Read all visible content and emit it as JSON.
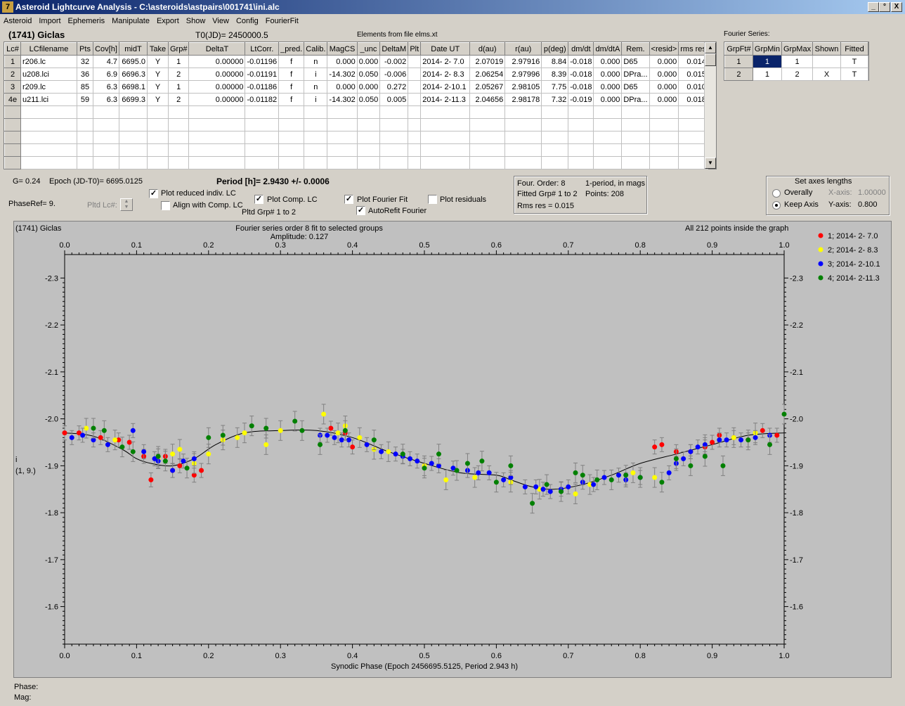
{
  "window": {
    "title": "Asteroid Lightcurve Analysis - C:\\asteroids\\astpairs\\001741\\ini.alc",
    "controls": [
      "_",
      "°",
      "X"
    ]
  },
  "menu": [
    "Asteroid",
    "Import",
    "Ephemeris",
    "Manipulate",
    "Export",
    "Show",
    "View",
    "Config",
    "FourierFit"
  ],
  "header": {
    "asteroid_name": "(1741) Giclas",
    "t0": "T0(JD)= 2450000.5",
    "elements": "Elements from file elms.xt"
  },
  "lc_table": {
    "columns": [
      "Lc#",
      "LCfilename",
      "Pts",
      "Cov[h]",
      "midT",
      "Take",
      "Grp#",
      "DeltaT",
      "LtCorr.",
      "_pred.",
      "Calib.",
      "MagCS",
      "_unc",
      "DeltaM",
      "Plt",
      "Date UT",
      "d(au)",
      "r(au)",
      "p(deg)",
      "dm/dt",
      "dm/dtA",
      "Rem.",
      "<resid>",
      "rms res"
    ],
    "rows": [
      [
        "1",
        "r206.lc",
        "32",
        "4.7",
        "6695.0",
        "Y",
        "1",
        "0.00000",
        "-0.01196",
        "f",
        "n",
        "0.000",
        "0.000",
        "-0.002",
        "",
        "2014- 2- 7.0",
        "2.07019",
        "2.97916",
        "8.84",
        "-0.018",
        "0.000",
        "D65",
        "0.000",
        "0.014"
      ],
      [
        "2",
        "u208.lci",
        "36",
        "6.9",
        "6696.3",
        "Y",
        "2",
        "0.00000",
        "-0.01191",
        "f",
        "i",
        "-14.302",
        "0.050",
        "-0.006",
        "",
        "2014- 2- 8.3",
        "2.06254",
        "2.97996",
        "8.39",
        "-0.018",
        "0.000",
        "DPra...",
        "0.000",
        "0.015"
      ],
      [
        "3",
        "r209.lc",
        "85",
        "6.3",
        "6698.1",
        "Y",
        "1",
        "0.00000",
        "-0.01186",
        "f",
        "n",
        "0.000",
        "0.000",
        "0.272",
        "",
        "2014- 2-10.1",
        "2.05267",
        "2.98105",
        "7.75",
        "-0.018",
        "0.000",
        "D65",
        "0.000",
        "0.010"
      ],
      [
        "4e",
        "u211.lci",
        "59",
        "6.3",
        "6699.3",
        "Y",
        "2",
        "0.00000",
        "-0.01182",
        "f",
        "i",
        "-14.302",
        "0.050",
        "0.005",
        "",
        "2014- 2-11.3",
        "2.04656",
        "2.98178",
        "7.32",
        "-0.019",
        "0.000",
        "DPra...",
        "0.000",
        "0.018"
      ]
    ]
  },
  "fourier_table": {
    "title": "Fourier Series:",
    "columns": [
      "GrpFt#",
      "GrpMin",
      "GrpMax",
      "Shown",
      "Fitted"
    ],
    "rows": [
      [
        "1",
        "1",
        "1",
        "",
        "T"
      ],
      [
        "2",
        "1",
        "2",
        "X",
        "T"
      ]
    ]
  },
  "controls": {
    "g": "G= 0.24",
    "epoch": "Epoch (JD-T0)= 6695.0125",
    "period": "Period [h]= 2.9430 +/- 0.0006",
    "phaseref": "PhaseRef= 9.",
    "pltd_lc": "Pltd Lc#:",
    "plot_reduced": "Plot reduced indiv. LC",
    "align_comp": "Align with Comp. LC",
    "plot_comp": "Plot Comp. LC",
    "pltd_grp": "Pltd Grp#  1  to  2",
    "plot_fourier": "Plot Fourier Fit",
    "autorefit": "AutoRefit Fourier",
    "plot_residuals": "Plot residuals",
    "four_order": "Four. Order:  8",
    "one_period": "1-period, in mags",
    "fitted_grp": "Fitted Grp# 1 to 2",
    "points": "Points: 208",
    "rms": "Rms res     = 0.015",
    "axes_title": "Set axes lengths",
    "overally": "Overally",
    "keep_axis": "Keep Axis",
    "xaxis_label": "X-axis:",
    "xaxis_val": "1.00000",
    "yaxis_label": "Y-axis:",
    "yaxis_val": "0.800"
  },
  "checks": {
    "plot_reduced": true,
    "align_comp": false,
    "plot_comp": true,
    "plot_fourier": true,
    "autorefit": true,
    "plot_residuals": false
  },
  "status": {
    "phase": "Phase:",
    "mag": "Mag:"
  },
  "chart_data": {
    "type": "scatter",
    "title": "Fourier series order 8 fit to selected groups",
    "subtitle": "Amplitude: 0.127",
    "top_left": "(1741) Giclas",
    "top_right": "All 212 points inside the graph",
    "xlabel": "Synodic Phase (Epoch 2456695.5125, Period 2.943 h)",
    "ylabel": "i",
    "ylabel2": "(1, 9.)",
    "xlim": [
      0.0,
      1.0
    ],
    "ylim": [
      -2.35,
      -1.52
    ],
    "y_inverted": true,
    "x_ticks": [
      "0.0",
      "0.1",
      "0.2",
      "0.3",
      "0.4",
      "0.5",
      "0.6",
      "0.7",
      "0.8",
      "0.9",
      "1.0"
    ],
    "y_ticks": [
      "-2.3",
      "-2.2",
      "-2.1",
      "-2.0",
      "-1.9",
      "-1.8",
      "-1.7",
      "-1.6"
    ],
    "series": [
      {
        "name": "1; 2014- 2- 7.0",
        "color": "#ff0000",
        "x": [
          0.0,
          0.02,
          0.05,
          0.075,
          0.09,
          0.11,
          0.12,
          0.14,
          0.15,
          0.16,
          0.18,
          0.19,
          0.37,
          0.39,
          0.4,
          0.82,
          0.83,
          0.85,
          0.87,
          0.89,
          0.9,
          0.91,
          0.93,
          0.95,
          0.97,
          0.99
        ],
        "y": [
          -1.97,
          -1.97,
          -1.96,
          -1.955,
          -1.95,
          -1.92,
          -1.87,
          -1.92,
          -1.89,
          -1.9,
          -1.88,
          -1.89,
          -1.98,
          -1.97,
          -1.94,
          -1.94,
          -1.945,
          -1.93,
          -1.93,
          -1.94,
          -1.95,
          -1.965,
          -1.96,
          -1.955,
          -1.975,
          -1.965
        ]
      },
      {
        "name": "2; 2014- 2- 8.3",
        "color": "#ffff00",
        "x": [
          0.03,
          0.07,
          0.13,
          0.15,
          0.16,
          0.18,
          0.2,
          0.22,
          0.24,
          0.25,
          0.28,
          0.3,
          0.36,
          0.38,
          0.39,
          0.41,
          0.43,
          0.45,
          0.5,
          0.53,
          0.57,
          0.62,
          0.66,
          0.71,
          0.73,
          0.79,
          0.82,
          0.89,
          0.93,
          0.96
        ],
        "y": [
          -1.98,
          -1.955,
          -1.915,
          -1.925,
          -1.935,
          -1.905,
          -1.925,
          -1.955,
          -1.96,
          -1.97,
          -1.945,
          -1.975,
          -2.01,
          -1.97,
          -1.985,
          -1.96,
          -1.935,
          -1.93,
          -1.9,
          -1.87,
          -1.875,
          -1.865,
          -1.85,
          -1.84,
          -1.86,
          -1.885,
          -1.875,
          -1.945,
          -1.96,
          -1.97
        ]
      },
      {
        "name": "3; 2014- 2-10.1",
        "color": "#0000ff",
        "x": [
          0.01,
          0.025,
          0.04,
          0.06,
          0.095,
          0.11,
          0.125,
          0.13,
          0.15,
          0.165,
          0.18,
          0.355,
          0.365,
          0.375,
          0.385,
          0.395,
          0.42,
          0.44,
          0.46,
          0.47,
          0.48,
          0.49,
          0.51,
          0.52,
          0.54,
          0.56,
          0.575,
          0.59,
          0.61,
          0.62,
          0.64,
          0.655,
          0.665,
          0.675,
          0.69,
          0.7,
          0.72,
          0.735,
          0.75,
          0.77,
          0.78,
          0.8,
          0.84,
          0.85,
          0.86,
          0.87,
          0.88,
          0.89,
          0.91,
          0.92,
          0.94,
          0.96,
          0.98
        ],
        "y": [
          -1.96,
          -1.965,
          -1.955,
          -1.945,
          -1.975,
          -1.93,
          -1.915,
          -1.91,
          -1.89,
          -1.91,
          -1.915,
          -1.965,
          -1.965,
          -1.96,
          -1.955,
          -1.955,
          -1.945,
          -1.93,
          -1.925,
          -1.92,
          -1.915,
          -1.91,
          -1.905,
          -1.9,
          -1.895,
          -1.89,
          -1.885,
          -1.885,
          -1.87,
          -1.875,
          -1.855,
          -1.855,
          -1.85,
          -1.845,
          -1.85,
          -1.855,
          -1.865,
          -1.86,
          -1.875,
          -1.88,
          -1.87,
          -1.875,
          -1.885,
          -1.905,
          -1.915,
          -1.93,
          -1.94,
          -1.945,
          -1.955,
          -1.955,
          -1.955,
          -1.96,
          -1.965
        ]
      },
      {
        "name": "4; 2014- 2-11.3",
        "color": "#008000",
        "x": [
          0.04,
          0.055,
          0.08,
          0.095,
          0.13,
          0.14,
          0.17,
          0.2,
          0.22,
          0.26,
          0.28,
          0.32,
          0.33,
          0.355,
          0.39,
          0.43,
          0.47,
          0.5,
          0.52,
          0.545,
          0.56,
          0.58,
          0.6,
          0.62,
          0.65,
          0.67,
          0.69,
          0.71,
          0.72,
          0.74,
          0.76,
          0.78,
          0.8,
          0.83,
          0.85,
          0.87,
          0.89,
          0.915,
          0.95,
          0.98,
          1.0
        ],
        "y": [
          -1.98,
          -1.975,
          -1.94,
          -1.93,
          -1.92,
          -1.91,
          -1.895,
          -1.96,
          -1.965,
          -1.985,
          -1.98,
          -1.995,
          -1.975,
          -1.945,
          -1.975,
          -1.955,
          -1.925,
          -1.895,
          -1.925,
          -1.89,
          -1.905,
          -1.91,
          -1.865,
          -1.9,
          -1.82,
          -1.86,
          -1.845,
          -1.885,
          -1.88,
          -1.87,
          -1.87,
          -1.88,
          -1.875,
          -1.865,
          -1.915,
          -1.9,
          -1.92,
          -1.9,
          -1.955,
          -1.945,
          -2.01
        ]
      }
    ],
    "fourier_fit": {
      "x": [
        0.0,
        0.04,
        0.08,
        0.1,
        0.12,
        0.15,
        0.18,
        0.21,
        0.25,
        0.3,
        0.35,
        0.4,
        0.45,
        0.5,
        0.55,
        0.6,
        0.62,
        0.65,
        0.68,
        0.72,
        0.76,
        0.8,
        0.85,
        0.9,
        0.95,
        1.0
      ],
      "y": [
        -1.97,
        -1.963,
        -1.935,
        -1.915,
        -1.905,
        -1.9,
        -1.915,
        -1.945,
        -1.97,
        -1.975,
        -1.975,
        -1.96,
        -1.93,
        -1.905,
        -1.885,
        -1.88,
        -1.87,
        -1.855,
        -1.85,
        -1.86,
        -1.88,
        -1.905,
        -1.925,
        -1.945,
        -1.965,
        -1.97
      ]
    }
  }
}
